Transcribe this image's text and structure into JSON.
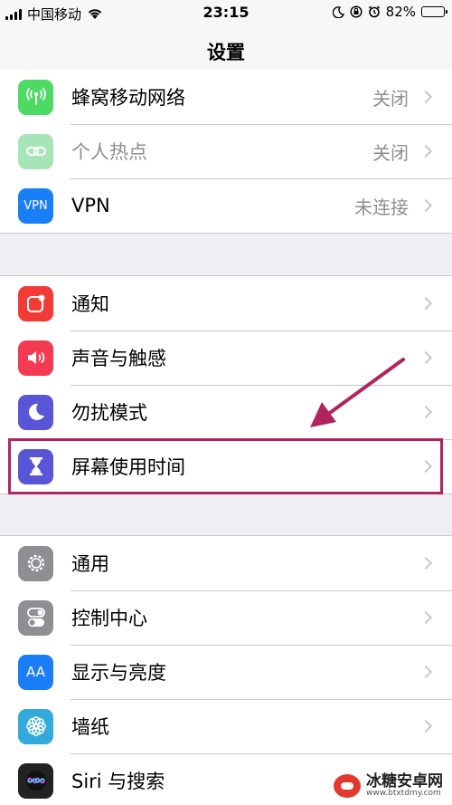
{
  "status_bar": {
    "carrier": "中国移动",
    "time": "23:15",
    "battery": "82%",
    "battery_level": 0.82
  },
  "nav": {
    "title": "设置"
  },
  "groups": [
    {
      "rows": [
        {
          "label": "蜂窝移动网络",
          "value": "关闭",
          "icon": "cellular-antenna-icon",
          "color": "#4cd964"
        },
        {
          "label": "个人热点",
          "value": "关闭",
          "icon": "hotspot-link-icon",
          "color": "#a6e5b5"
        },
        {
          "label": "VPN",
          "value": "未连接",
          "icon": "vpn-icon",
          "icon_text": "VPN",
          "color": "#1a7ef6"
        }
      ]
    },
    {
      "rows": [
        {
          "label": "通知",
          "icon": "notification-icon",
          "color": "#f23b34"
        },
        {
          "label": "声音与触感",
          "icon": "speaker-icon",
          "color": "#f23b52"
        },
        {
          "label": "勿扰模式",
          "icon": "moon-icon",
          "color": "#5856d6"
        },
        {
          "label": "屏幕使用时间",
          "icon": "hourglass-icon",
          "color": "#5856d6"
        }
      ]
    },
    {
      "rows": [
        {
          "label": "通用",
          "icon": "gear-icon",
          "color": "#8e8e93"
        },
        {
          "label": "控制中心",
          "icon": "toggles-icon",
          "color": "#8e8e93"
        },
        {
          "label": "显示与亮度",
          "icon": "text-size-icon",
          "icon_text": "AA",
          "color": "#1a7ef6"
        },
        {
          "label": "墙纸",
          "icon": "flower-icon",
          "color": "#34aadc"
        },
        {
          "label": "Siri 与搜索",
          "icon": "siri-icon",
          "color": "#222"
        }
      ]
    }
  ],
  "annotation": {
    "color": "#b2245f"
  },
  "watermark": {
    "title": "冰糖安卓网",
    "url": "www.btxtdmy.com"
  }
}
